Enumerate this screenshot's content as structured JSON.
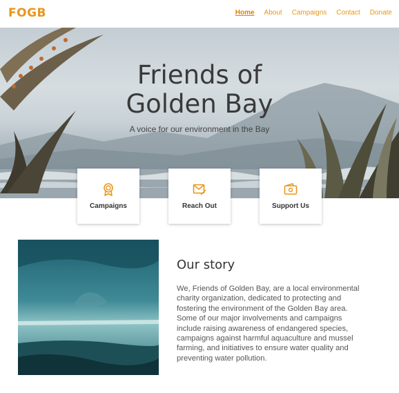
{
  "header": {
    "logo": "FOGB",
    "nav": [
      {
        "label": "Home",
        "active": true
      },
      {
        "label": "About"
      },
      {
        "label": "Campaigns"
      },
      {
        "label": "Contact"
      },
      {
        "label": "Donate"
      }
    ]
  },
  "hero": {
    "title_line1": "Friends of",
    "title_line2": "Golden Bay",
    "subtitle": "A voice for our environment in the Bay"
  },
  "cards": [
    {
      "label": "Campaigns",
      "icon": "award-icon"
    },
    {
      "label": "Reach Out",
      "icon": "mail-edit-icon"
    },
    {
      "label": "Support Us",
      "icon": "wallet-icon"
    }
  ],
  "story": {
    "title": "Our story",
    "text": "We, Friends of Golden Bay, are a local environmental charity organization, dedicated to protecting and fostering the environment of the Golden Bay area. Some of our major involvements and campaigns include raising awareness of endangered species, campaigns against harmful aquaculture and mussel farming, and initiatives to ensure water quality and preventing water pollution."
  },
  "colors": {
    "accent": "#e8961c",
    "accent_active": "#e07f00"
  }
}
